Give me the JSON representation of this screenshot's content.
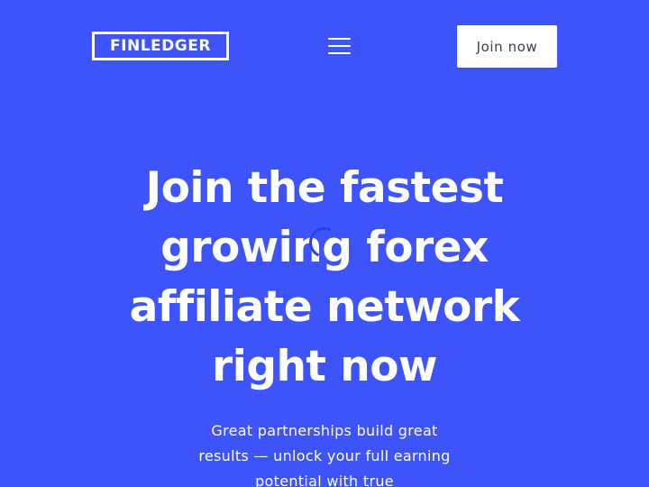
{
  "header": {
    "logo_text": "FINLEDGER",
    "menu_icon": "hamburger-menu-icon",
    "join_label": "Join now"
  },
  "hero": {
    "title": "Join the fastest growing forex affiliate network right now",
    "subtitle": "Great partnerships build great results — unlock your full earning potential with true"
  },
  "loading": {
    "icon": "loading-spinner-icon"
  },
  "colors": {
    "background": "#3d53fb",
    "button_bg": "#ffffff",
    "button_text": "#3a3f55",
    "text": "#ffffff",
    "spinner": "#2b3fe6"
  }
}
